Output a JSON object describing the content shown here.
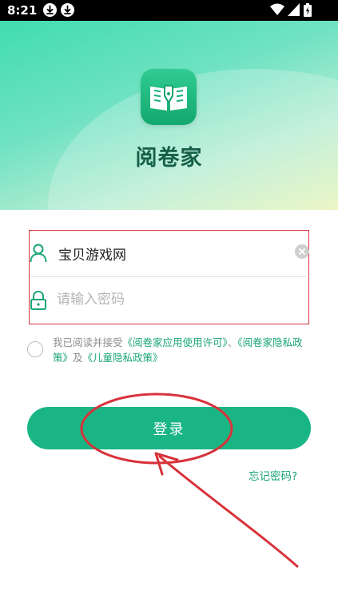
{
  "status_bar": {
    "time": "8:21",
    "icons": [
      "download-icon",
      "download-icon",
      "wifi-icon",
      "signal-icon",
      "battery-icon"
    ]
  },
  "app": {
    "name": "阅卷家",
    "logo_icon": "book-pen-icon"
  },
  "login": {
    "username": {
      "value": "宝贝游戏网",
      "icon": "user-icon"
    },
    "password": {
      "placeholder": "请输入密码",
      "icon": "lock-icon"
    },
    "agreement": {
      "prefix": "我已阅读并接受",
      "link1": "《阅卷家应用使用许可》",
      "sep": "、",
      "link2": "《阅卷家隐私政策》",
      "and": "及",
      "link3": "《儿童隐私政策》"
    },
    "submit_label": "登录",
    "forgot_label": "忘记密码?"
  },
  "colors": {
    "accent": "#1ab584",
    "annotation": "#d8323b",
    "brand_text": "#165f49"
  }
}
